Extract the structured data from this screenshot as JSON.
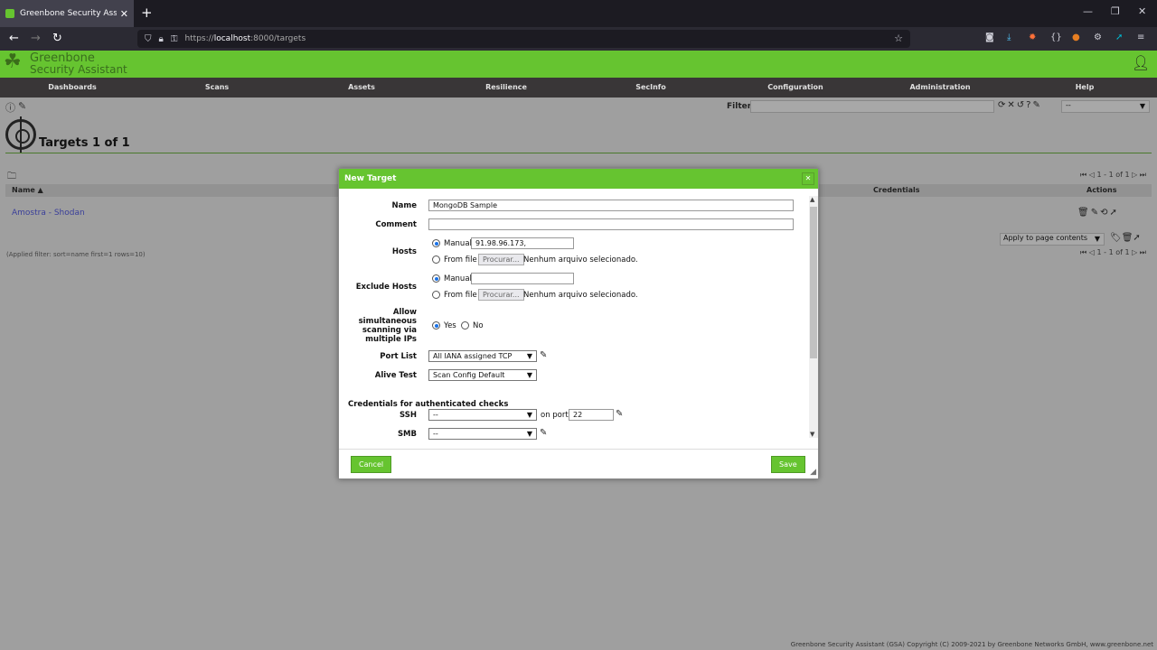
{
  "browser": {
    "tab_title": "Greenbone Security Assistant - ",
    "url_prefix": "https://",
    "url_host": "localhost",
    "url_rest": ":8000/targets"
  },
  "app": {
    "brand_line1": "Greenbone",
    "brand_line2": "Security Assistant"
  },
  "menu": [
    "Dashboards",
    "Scans",
    "Assets",
    "Resilience",
    "SecInfo",
    "Configuration",
    "Administration",
    "Help"
  ],
  "page": {
    "filter_label": "Filter",
    "filter_select": "--",
    "title": "Targets 1 of 1",
    "pager_text": "1 - 1 of 1",
    "columns": {
      "name": "Name ▲",
      "credentials": "Credentials",
      "actions": "Actions"
    },
    "row_name": "Amostra - Shodan",
    "apply_select": "Apply to page contents",
    "applied_filter": "(Applied filter: sort=name first=1 rows=10)",
    "copyright": "Greenbone Security Assistant (GSA) Copyright (C) 2009-2021 by Greenbone Networks GmbH, www.greenbone.net"
  },
  "dialog": {
    "title": "New Target",
    "name_label": "Name",
    "name_value": "MongoDB Sample",
    "comment_label": "Comment",
    "comment_value": "",
    "hosts_label": "Hosts",
    "manual_label": "Manual",
    "hosts_value": "91.98.96.173,",
    "from_file_label": "From file",
    "browse_label": "Procurar...",
    "no_file_label": "Nenhum arquivo selecionado.",
    "exclude_label": "Exclude Hosts",
    "exclude_value": "",
    "allow_label_1": "Allow",
    "allow_label_2": "simultaneous",
    "allow_label_3": "scanning via",
    "allow_label_4": "multiple IPs",
    "yes_label": "Yes",
    "no_label": "No",
    "portlist_label": "Port List",
    "portlist_value": "All IANA assigned TCP",
    "alive_label": "Alive Test",
    "alive_value": "Scan Config Default",
    "credentials_section": "Credentials for authenticated checks",
    "ssh_label": "SSH",
    "ssh_value": "--",
    "on_port_label": "on port",
    "ssh_port": "22",
    "smb_label": "SMB",
    "smb_value": "--",
    "cancel_label": "Cancel",
    "save_label": "Save"
  }
}
